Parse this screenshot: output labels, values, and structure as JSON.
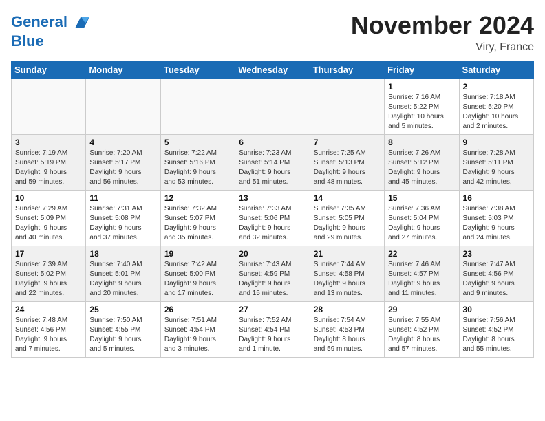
{
  "header": {
    "logo_line1": "General",
    "logo_line2": "Blue",
    "month": "November 2024",
    "location": "Viry, France"
  },
  "weekdays": [
    "Sunday",
    "Monday",
    "Tuesday",
    "Wednesday",
    "Thursday",
    "Friday",
    "Saturday"
  ],
  "weeks": [
    [
      {
        "day": "",
        "info": "",
        "empty": true
      },
      {
        "day": "",
        "info": "",
        "empty": true
      },
      {
        "day": "",
        "info": "",
        "empty": true
      },
      {
        "day": "",
        "info": "",
        "empty": true
      },
      {
        "day": "",
        "info": "",
        "empty": true
      },
      {
        "day": "1",
        "info": "Sunrise: 7:16 AM\nSunset: 5:22 PM\nDaylight: 10 hours\nand 5 minutes.",
        "empty": false
      },
      {
        "day": "2",
        "info": "Sunrise: 7:18 AM\nSunset: 5:20 PM\nDaylight: 10 hours\nand 2 minutes.",
        "empty": false
      }
    ],
    [
      {
        "day": "3",
        "info": "Sunrise: 7:19 AM\nSunset: 5:19 PM\nDaylight: 9 hours\nand 59 minutes.",
        "empty": false
      },
      {
        "day": "4",
        "info": "Sunrise: 7:20 AM\nSunset: 5:17 PM\nDaylight: 9 hours\nand 56 minutes.",
        "empty": false
      },
      {
        "day": "5",
        "info": "Sunrise: 7:22 AM\nSunset: 5:16 PM\nDaylight: 9 hours\nand 53 minutes.",
        "empty": false
      },
      {
        "day": "6",
        "info": "Sunrise: 7:23 AM\nSunset: 5:14 PM\nDaylight: 9 hours\nand 51 minutes.",
        "empty": false
      },
      {
        "day": "7",
        "info": "Sunrise: 7:25 AM\nSunset: 5:13 PM\nDaylight: 9 hours\nand 48 minutes.",
        "empty": false
      },
      {
        "day": "8",
        "info": "Sunrise: 7:26 AM\nSunset: 5:12 PM\nDaylight: 9 hours\nand 45 minutes.",
        "empty": false
      },
      {
        "day": "9",
        "info": "Sunrise: 7:28 AM\nSunset: 5:11 PM\nDaylight: 9 hours\nand 42 minutes.",
        "empty": false
      }
    ],
    [
      {
        "day": "10",
        "info": "Sunrise: 7:29 AM\nSunset: 5:09 PM\nDaylight: 9 hours\nand 40 minutes.",
        "empty": false
      },
      {
        "day": "11",
        "info": "Sunrise: 7:31 AM\nSunset: 5:08 PM\nDaylight: 9 hours\nand 37 minutes.",
        "empty": false
      },
      {
        "day": "12",
        "info": "Sunrise: 7:32 AM\nSunset: 5:07 PM\nDaylight: 9 hours\nand 35 minutes.",
        "empty": false
      },
      {
        "day": "13",
        "info": "Sunrise: 7:33 AM\nSunset: 5:06 PM\nDaylight: 9 hours\nand 32 minutes.",
        "empty": false
      },
      {
        "day": "14",
        "info": "Sunrise: 7:35 AM\nSunset: 5:05 PM\nDaylight: 9 hours\nand 29 minutes.",
        "empty": false
      },
      {
        "day": "15",
        "info": "Sunrise: 7:36 AM\nSunset: 5:04 PM\nDaylight: 9 hours\nand 27 minutes.",
        "empty": false
      },
      {
        "day": "16",
        "info": "Sunrise: 7:38 AM\nSunset: 5:03 PM\nDaylight: 9 hours\nand 24 minutes.",
        "empty": false
      }
    ],
    [
      {
        "day": "17",
        "info": "Sunrise: 7:39 AM\nSunset: 5:02 PM\nDaylight: 9 hours\nand 22 minutes.",
        "empty": false
      },
      {
        "day": "18",
        "info": "Sunrise: 7:40 AM\nSunset: 5:01 PM\nDaylight: 9 hours\nand 20 minutes.",
        "empty": false
      },
      {
        "day": "19",
        "info": "Sunrise: 7:42 AM\nSunset: 5:00 PM\nDaylight: 9 hours\nand 17 minutes.",
        "empty": false
      },
      {
        "day": "20",
        "info": "Sunrise: 7:43 AM\nSunset: 4:59 PM\nDaylight: 9 hours\nand 15 minutes.",
        "empty": false
      },
      {
        "day": "21",
        "info": "Sunrise: 7:44 AM\nSunset: 4:58 PM\nDaylight: 9 hours\nand 13 minutes.",
        "empty": false
      },
      {
        "day": "22",
        "info": "Sunrise: 7:46 AM\nSunset: 4:57 PM\nDaylight: 9 hours\nand 11 minutes.",
        "empty": false
      },
      {
        "day": "23",
        "info": "Sunrise: 7:47 AM\nSunset: 4:56 PM\nDaylight: 9 hours\nand 9 minutes.",
        "empty": false
      }
    ],
    [
      {
        "day": "24",
        "info": "Sunrise: 7:48 AM\nSunset: 4:56 PM\nDaylight: 9 hours\nand 7 minutes.",
        "empty": false
      },
      {
        "day": "25",
        "info": "Sunrise: 7:50 AM\nSunset: 4:55 PM\nDaylight: 9 hours\nand 5 minutes.",
        "empty": false
      },
      {
        "day": "26",
        "info": "Sunrise: 7:51 AM\nSunset: 4:54 PM\nDaylight: 9 hours\nand 3 minutes.",
        "empty": false
      },
      {
        "day": "27",
        "info": "Sunrise: 7:52 AM\nSunset: 4:54 PM\nDaylight: 9 hours\nand 1 minute.",
        "empty": false
      },
      {
        "day": "28",
        "info": "Sunrise: 7:54 AM\nSunset: 4:53 PM\nDaylight: 8 hours\nand 59 minutes.",
        "empty": false
      },
      {
        "day": "29",
        "info": "Sunrise: 7:55 AM\nSunset: 4:52 PM\nDaylight: 8 hours\nand 57 minutes.",
        "empty": false
      },
      {
        "day": "30",
        "info": "Sunrise: 7:56 AM\nSunset: 4:52 PM\nDaylight: 8 hours\nand 55 minutes.",
        "empty": false
      }
    ]
  ]
}
